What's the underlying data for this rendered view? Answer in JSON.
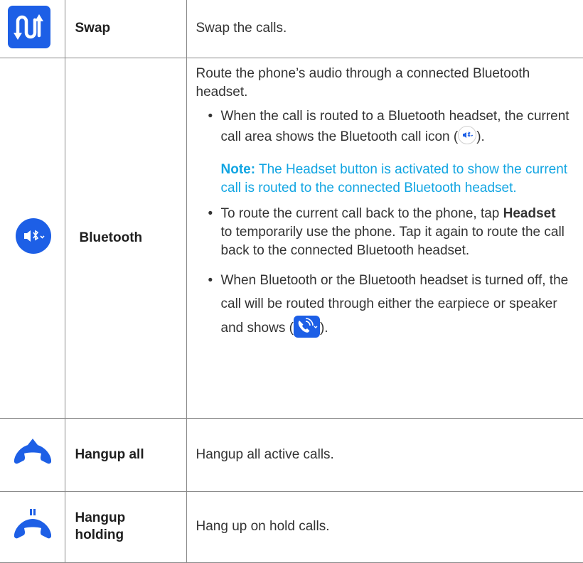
{
  "rows": [
    {
      "icon": "swap-icon",
      "name": "Swap",
      "desc": "Swap the calls."
    },
    {
      "icon": "bluetooth-audio-icon",
      "name": "Bluetooth",
      "intro": "Route the phone’s audio through a connected Bluetooth headset.",
      "bullet1_pre": "When the call is routed to a Bluetooth headset, the current call area shows the Bluetooth call icon (",
      "bullet1_post": ").",
      "note_label": "Note:",
      "note_text": " The Headset button is activated to show the current call is routed to the connected Bluetooth headset.",
      "bullet2_pre": "To route the current call back to the phone, tap ",
      "bullet2_bold": "Headset",
      "bullet2_post": " to temporarily use the phone. Tap it again to route the call back to the connected Bluetooth headset.",
      "bullet3_pre": "When Bluetooth or the Bluetooth headset is turned off, the call will be routed through either the earpiece or speaker and shows (",
      "bullet3_post": ")."
    },
    {
      "icon": "hangup-all-icon",
      "name": "Hangup all",
      "desc": "Hangup all active calls."
    },
    {
      "icon": "hangup-holding-icon",
      "name_line1": "Hangup",
      "name_line2": "holding",
      "desc": "Hang up on hold calls."
    }
  ],
  "colors": {
    "accent": "#1d5fe6",
    "note": "#12a5e2",
    "border": "#8a8a8a"
  }
}
